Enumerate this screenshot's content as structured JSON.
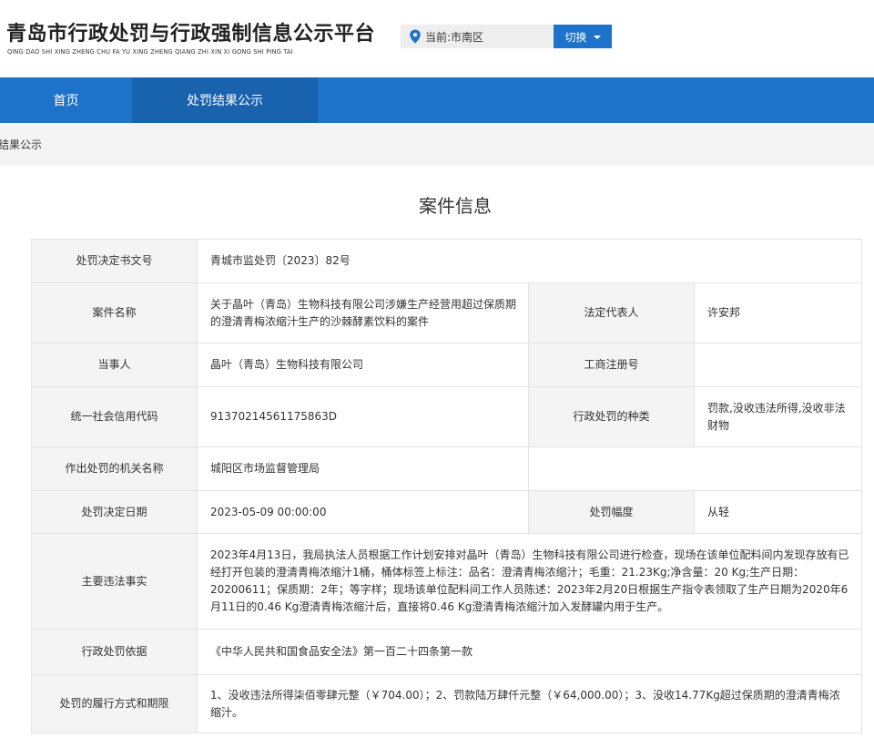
{
  "header": {
    "title": "青岛市行政处罚与行政强制信息公示平台",
    "subtitle": "QING DAO SHI XING ZHENG CHU FA YU XING ZHENG QIANG ZHI XIN XI GONG SHI PING TAI",
    "location_label": "当前:市南区",
    "switch_label": "切换"
  },
  "nav": {
    "items": [
      {
        "label": "首页"
      },
      {
        "label": "处罚结果公示"
      }
    ]
  },
  "breadcrumb": "罚结果公示",
  "page_title": "案件信息",
  "table": {
    "decision_no": {
      "label": "处罚决定书文号",
      "value": "青城市监处罚〔2023〕82号"
    },
    "case_name": {
      "label": "案件名称",
      "value": "关于晶叶（青岛）生物科技有限公司涉嫌生产经营用超过保质期 的澄清青梅浓缩汁生产的沙棘酵素饮料的案件"
    },
    "legal_rep": {
      "label": "法定代表人",
      "value": "许安邦"
    },
    "party": {
      "label": "当事人",
      "value": "晶叶（青岛）生物科技有限公司"
    },
    "business_reg_no": {
      "label": "工商注册号",
      "value": ""
    },
    "credit_code": {
      "label": "统一社会信用代码",
      "value": "91370214561175863D"
    },
    "penalty_type": {
      "label": "行政处罚的种类",
      "value": "罚款,没收违法所得,没收非法财物"
    },
    "authority": {
      "label": "作出处罚的机关名称",
      "value": "城阳区市场监督管理局"
    },
    "decision_date": {
      "label": "处罚决定日期",
      "value": "2023-05-09 00:00:00"
    },
    "penalty_range": {
      "label": "处罚幅度",
      "value": "从轻"
    },
    "facts": {
      "label": "主要违法事实",
      "value": "2023年4月13日，我局执法人员根据工作计划安排对晶叶（青岛）生物科技有限公司进行检查，现场在该单位配料间内发现存放有已经打开包装的澄清青梅浓缩汁1桶，桶体标签上标注：品名：澄清青梅浓缩汁；毛重：21.23Kg;净含量：20 Kg;生产日期：20200611；保质期：2年；等字样；现场该单位配料间工作人员陈述：2023年2月20日根据生产指令表领取了生产日期为2020年6月11日的0.46 Kg澄清青梅浓缩汁后，直接将0.46 Kg澄清青梅浓缩汁加入发酵罐内用于生产。"
    },
    "basis": {
      "label": "行政处罚依据",
      "value": "《中华人民共和国食品安全法》第一百二十四条第一款"
    },
    "execution": {
      "label": "处罚的履行方式和期限",
      "value": "1、没收违法所得柒佰零肆元整（￥704.00）；2、罚款陆万肆仟元整（￥64,000.00）；3、没收14.77Kg超过保质期的澄清青梅浓缩汁。"
    }
  }
}
